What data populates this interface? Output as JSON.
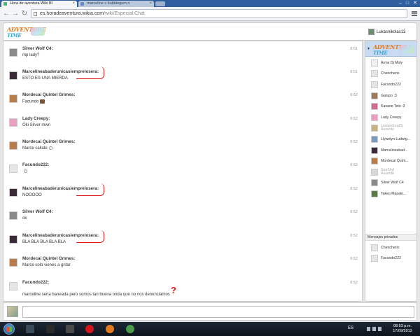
{
  "browser": {
    "tabs": [
      {
        "label": "Hora de aventura Wiki Bl"
      },
      {
        "label": "marceline s bubblegum o"
      }
    ],
    "url_host": "es.horadeaventura.wikia.com",
    "url_path": "/wiki/Especial:Chat",
    "window_controls": {
      "minimize": "–",
      "maximize": "□",
      "close": "✕"
    },
    "icons": {
      "back": "arrow-left-icon",
      "forward": "arrow-right-icon",
      "reload": "reload-icon",
      "menu": "hamburger-menu-icon"
    }
  },
  "header": {
    "logo_text_1": "ADVENTURE",
    "logo_text_2": "TIME",
    "current_user": "Lukasnikolas13"
  },
  "messages": [
    {
      "author": "Silver Wolf C4:",
      "text": "mp lady?",
      "time": "8:51",
      "avatar_color": "#8a8a8a"
    },
    {
      "author": "Marcelineabaderunicasiemprelosera:",
      "text": "ESTO ES UNA MIERDA",
      "time": "8:51",
      "avatar_color": "#3a2a3a"
    },
    {
      "author": "Mordecai Quintel Grimes:",
      "text": "Facundo",
      "time": "8:52",
      "avatar_color": "#b87d4b",
      "emoticon": true
    },
    {
      "author": "Lady Creepy:",
      "text": "Oki Silver mwn",
      "time": "8:52",
      "avatar_color": "#e9a1c1"
    },
    {
      "author": "Mordecai Quintel Grimes:",
      "text": "Marce callate",
      "time": "8:52",
      "avatar_color": "#b87d4b",
      "emoticon2": true
    },
    {
      "author": "Facundo222:",
      "text": "",
      "time": "8:52",
      "avatar_color": "#e6e6e6",
      "emoticon2": true
    },
    {
      "author": "Marcelineabaderunicasiemprelosera:",
      "text": "NOOOOO",
      "time": "8:52",
      "avatar_color": "#3a2a3a"
    },
    {
      "author": "Silver Wolf C4:",
      "text": "ok",
      "time": "8:52",
      "avatar_color": "#8a8a8a"
    },
    {
      "author": "Marcelineabaderunicasiemprelosera:",
      "text": "BLA BLA BLA BLA BLA",
      "time": "8:52",
      "avatar_color": "#3a2a3a"
    },
    {
      "author": "Mordecai Quintel Grimes:",
      "text": "Marce solo vienes a gritar",
      "time": "8:52",
      "avatar_color": "#b87d4b"
    },
    {
      "author": "Facundo222:",
      "text": "marceline seria baneada pero somos tan buena onda que no nos denunciamos",
      "time": "8:52",
      "avatar_color": "#e6e6e6"
    }
  ],
  "annotations": {
    "question_mark": "?"
  },
  "sidebar": {
    "collapse_glyph": "▾",
    "users": [
      {
        "name": "Arme Dj Moly",
        "avatar_color": "#f0f0f0",
        "away": false
      },
      {
        "name": "Chencherio",
        "avatar_color": "#e6e6e6",
        "away": false
      },
      {
        "name": "Facundo222",
        "avatar_color": "#e6e6e6",
        "away": false
      },
      {
        "name": "Gatupo :3",
        "avatar_color": "#9a7a5a",
        "away": false
      },
      {
        "name": "Kasane Teto :3",
        "avatar_color": "#d46a8a",
        "away": false
      },
      {
        "name": "Lady Creepy",
        "avatar_color": "#e9a1c1",
        "away": false
      },
      {
        "name": "Leslandrea89",
        "name2": "Ausente",
        "avatar_color": "#c8b080",
        "away": true
      },
      {
        "name": "Llywelyn Ludwig...",
        "avatar_color": "#7a9ac0",
        "away": false
      },
      {
        "name": "Marcelineabad...",
        "avatar_color": "#3a2a3a",
        "away": false
      },
      {
        "name": "Mordecai Quint...",
        "avatar_color": "#b87d4b",
        "away": false
      },
      {
        "name": "SeaShyl",
        "name2": "Ausente",
        "avatar_color": "#d8d8d8",
        "away": true
      },
      {
        "name": "Silver Wolf C4",
        "avatar_color": "#8a8a8a",
        "away": false
      },
      {
        "name": "Takeo Masaki...",
        "avatar_color": "#5a7a4a",
        "away": false
      }
    ],
    "pm_title": "Mensajes privados",
    "pm_users": [
      {
        "name": "Chencherio",
        "avatar_color": "#e6e6e6"
      },
      {
        "name": "Facundo222",
        "avatar_color": "#e6e6e6"
      }
    ]
  },
  "taskbar": {
    "language": "ES",
    "time": "08:53 p.m.",
    "date": "17/09/2013",
    "apps": [
      {
        "name": "windows-explorer-icon",
        "color": "#3a4a5a"
      },
      {
        "name": "command-prompt-icon",
        "color": "#2b2b2b"
      },
      {
        "name": "media-player-icon",
        "color": "#4a4a4a"
      },
      {
        "name": "opera-icon",
        "color": "#d3141c"
      },
      {
        "name": "firefox-icon",
        "color": "#e07a1f"
      },
      {
        "name": "chrome-icon",
        "color": "#4a9a4a"
      }
    ]
  }
}
